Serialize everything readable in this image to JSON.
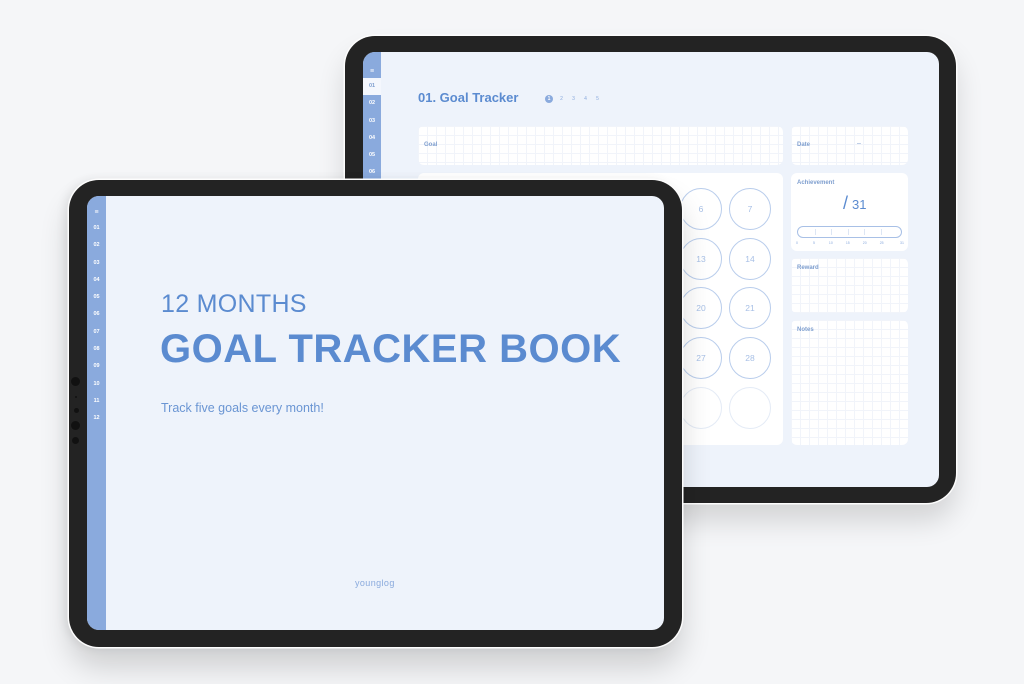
{
  "colors": {
    "accent": "#5b8bd0",
    "sidebar": "#8aaadd",
    "screen_bg": "#eef3fb",
    "bezel": "#232323",
    "background": "#f5f6f8",
    "circle_border": "#b9cdec"
  },
  "back_tablet": {
    "sidebar": {
      "menu_icon": "hamburger-menu-icon",
      "menu_glyph": "≡",
      "items": [
        "01",
        "02",
        "03",
        "04",
        "05",
        "06"
      ],
      "active_index": 0
    },
    "page_title": "01. Goal Tracker",
    "pager": {
      "pages": [
        "1",
        "2",
        "3",
        "4",
        "5"
      ],
      "active": "1"
    },
    "goal": {
      "label": "Goal"
    },
    "date": {
      "label": "Date",
      "value": "–"
    },
    "calendar": {
      "visible_days": [
        [
          "6",
          "7"
        ],
        [
          "13",
          "14"
        ],
        [
          "20",
          "21"
        ],
        [
          "27",
          "28"
        ],
        [
          "",
          ""
        ]
      ]
    },
    "achievement": {
      "label": "Achievement",
      "slash": "/",
      "total": "31",
      "scale": [
        "0",
        "5",
        "10",
        "15",
        "20",
        "25",
        "31"
      ],
      "progress": 0
    },
    "reward": {
      "label": "Reward"
    },
    "notes": {
      "label": "Notes"
    }
  },
  "front_tablet": {
    "sidebar": {
      "menu_icon": "hamburger-menu-icon",
      "menu_glyph": "≡",
      "items": [
        "01",
        "02",
        "03",
        "04",
        "05",
        "06",
        "07",
        "08",
        "09",
        "10",
        "11",
        "12"
      ]
    },
    "cover": {
      "subtitle": "12 MONTHS",
      "title": "GOAL TRACKER BOOK",
      "tagline": "Track five goals every month!",
      "brand": "younglog"
    }
  }
}
